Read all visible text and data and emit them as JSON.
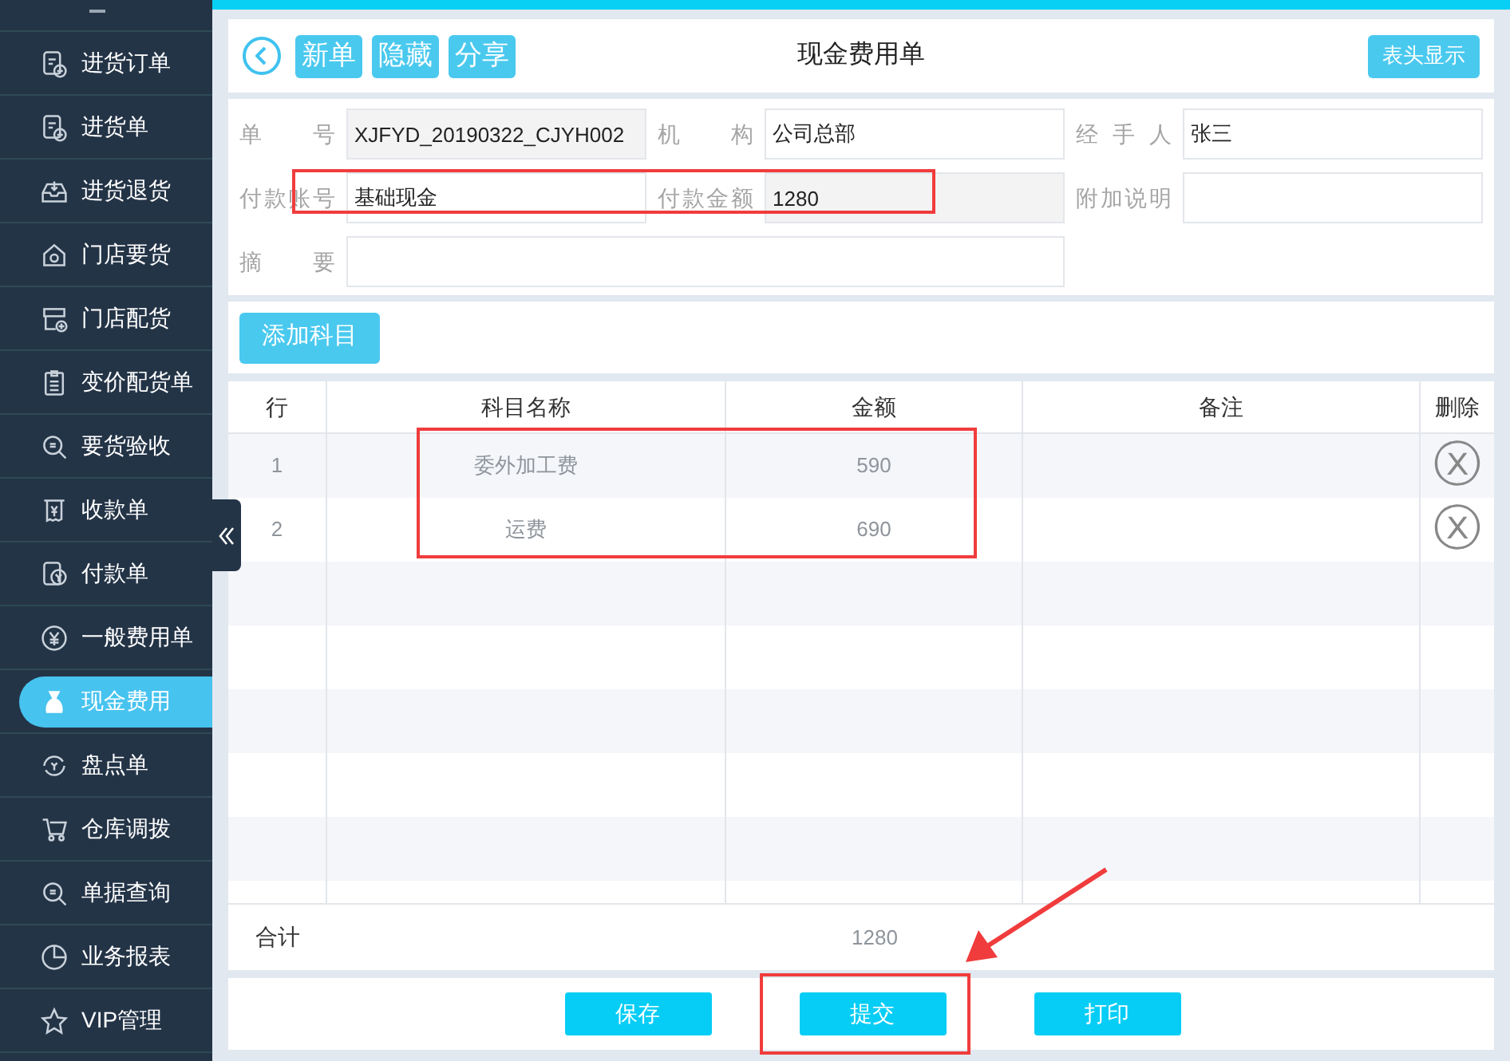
{
  "sidebar": {
    "items": [
      {
        "label": "进货订单",
        "selected": false
      },
      {
        "label": "进货单",
        "selected": false
      },
      {
        "label": "进货退货",
        "selected": false
      },
      {
        "label": "门店要货",
        "selected": false
      },
      {
        "label": "门店配货",
        "selected": false
      },
      {
        "label": "变价配货单",
        "selected": false
      },
      {
        "label": "要货验收",
        "selected": false
      },
      {
        "label": "收款单",
        "selected": false
      },
      {
        "label": "付款单",
        "selected": false
      },
      {
        "label": "一般费用单",
        "selected": false
      },
      {
        "label": "现金费用",
        "selected": true
      },
      {
        "label": "盘点单",
        "selected": false
      },
      {
        "label": "仓库调拨",
        "selected": false
      },
      {
        "label": "单据查询",
        "selected": false
      },
      {
        "label": "业务报表",
        "selected": false
      },
      {
        "label": "VIP管理",
        "selected": false
      }
    ]
  },
  "toolbar": {
    "buttons": [
      "新单",
      "隐藏",
      "分享"
    ],
    "title": "现金费用单",
    "header_toggle": "表头显示"
  },
  "form": {
    "fields": [
      {
        "label": "单号",
        "value": "XJFYD_20190322_CJYH002",
        "readonly": true
      },
      {
        "label": "机构",
        "value": "公司总部",
        "readonly": false
      },
      {
        "label": "经手人",
        "value": "张三",
        "readonly": false
      },
      {
        "label": "付款账号",
        "value": "基础现金",
        "readonly": false
      },
      {
        "label": "付款金额",
        "value": "1280",
        "readonly": true
      },
      {
        "label": "附加说明",
        "readonly": false
      },
      {
        "label": "摘要",
        "readonly": false,
        "wide": true
      }
    ]
  },
  "add_button": "添加科目",
  "table": {
    "columns": [
      "行",
      "科目名称",
      "金额",
      "备注",
      "删除"
    ],
    "rows": [
      {
        "row": "1",
        "name": "委外加工费",
        "amount": "590",
        "delete": "ⓧ"
      },
      {
        "row": "2",
        "name": "运费",
        "amount": "690",
        "delete": "ⓧ"
      }
    ],
    "total_label": "合计",
    "total": "1280"
  },
  "footer_buttons": [
    "保存",
    "提交",
    "打印"
  ],
  "annotations": [
    {
      "kind": "box"
    },
    {
      "kind": "box"
    },
    {
      "kind": "box"
    },
    {
      "kind": "arrow"
    }
  ]
}
